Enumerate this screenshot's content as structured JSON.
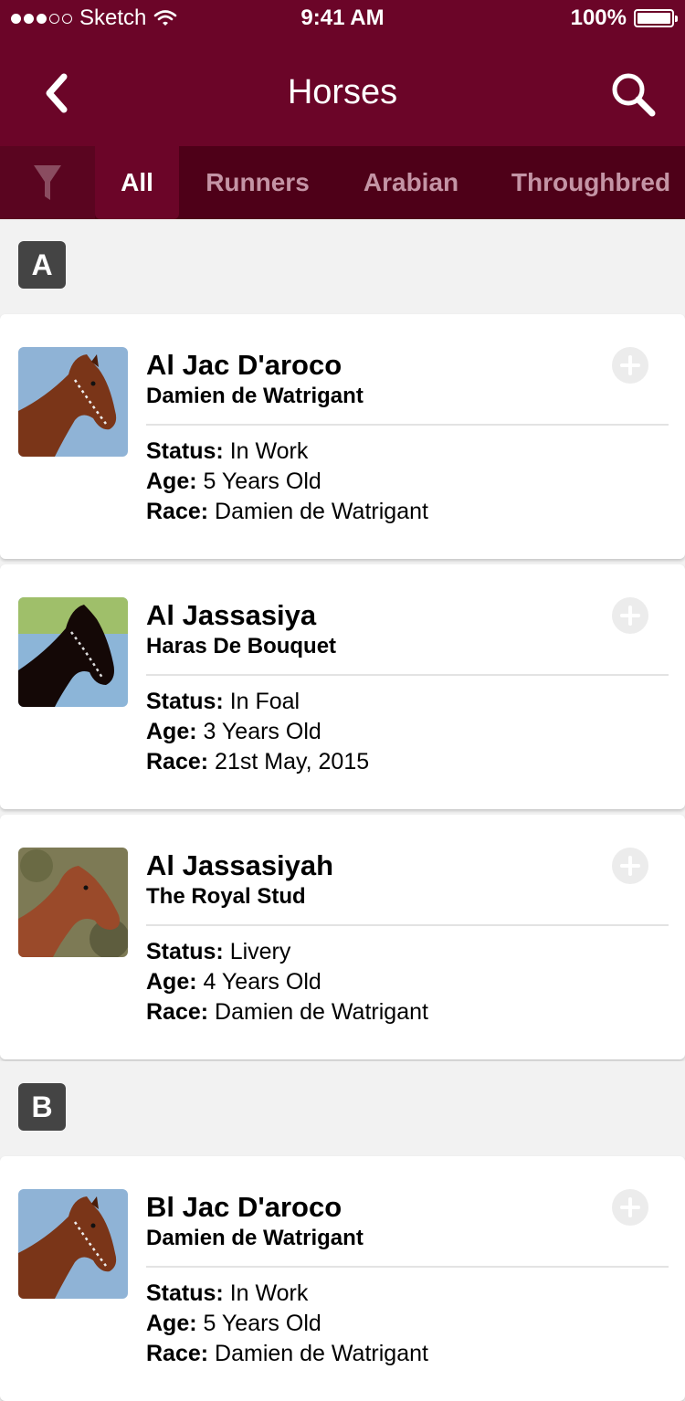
{
  "status_bar": {
    "carrier": "Sketch",
    "time": "9:41 AM",
    "battery": "100%"
  },
  "nav": {
    "title": "Horses"
  },
  "tabs": [
    {
      "label": "All",
      "active": true
    },
    {
      "label": "Runners",
      "active": false
    },
    {
      "label": "Arabian",
      "active": false
    },
    {
      "label": "Throughbred",
      "active": false
    }
  ],
  "labels": {
    "status": "Status:",
    "age": "Age:",
    "race": "Race:"
  },
  "sections": [
    {
      "letter": "A",
      "horses": [
        {
          "name": "Al Jac D'aroco",
          "owner": "Damien de Watrigant",
          "status": "In Work",
          "age": "5 Years Old",
          "race": "Damien de Watrigant"
        },
        {
          "name": "Al Jassasiya",
          "owner": "Haras De Bouquet",
          "status": "In Foal",
          "age": "3 Years Old",
          "race": "21st May, 2015"
        },
        {
          "name": "Al Jassasiyah",
          "owner": "The Royal Stud",
          "status": "Livery",
          "age": "4 Years Old",
          "race": "Damien de Watrigant"
        }
      ]
    },
    {
      "letter": "B",
      "horses": [
        {
          "name": "Bl Jac D'aroco",
          "owner": "Damien de Watrigant",
          "status": "In Work",
          "age": "5 Years Old",
          "race": "Damien de Watrigant"
        }
      ]
    }
  ],
  "colors": {
    "header": "#6b0528",
    "tabbar": "#4e0018",
    "tab_inactive": "#c494a5",
    "badge": "#444444"
  }
}
